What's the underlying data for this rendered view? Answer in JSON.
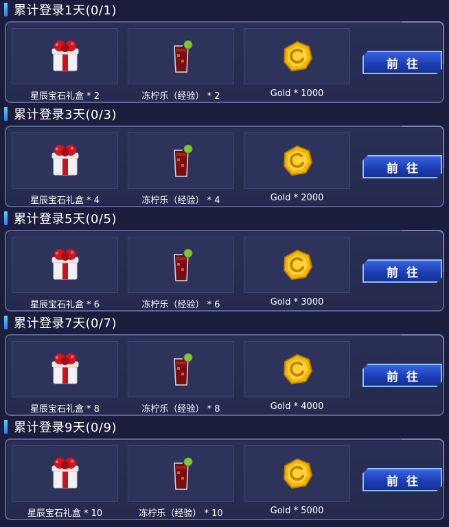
{
  "sections": [
    {
      "title": "累计登录1天(0/1)",
      "rewards": [
        "星辰宝石礼盒 * 2",
        "冻柠乐（经验） * 2",
        "Gold * 1000"
      ],
      "button": "前往"
    },
    {
      "title": "累计登录3天(0/3)",
      "rewards": [
        "星辰宝石礼盒 * 4",
        "冻柠乐（经验） * 4",
        "Gold * 2000"
      ],
      "button": "前往"
    },
    {
      "title": "累计登录5天(0/5)",
      "rewards": [
        "星辰宝石礼盒 * 6",
        "冻柠乐（经验） * 6",
        "Gold * 3000"
      ],
      "button": "前往"
    },
    {
      "title": "累计登录7天(0/7)",
      "rewards": [
        "星辰宝石礼盒 * 8",
        "冻柠乐（经验） * 8",
        "Gold * 4000"
      ],
      "button": "前往"
    },
    {
      "title": "累计登录9天(0/9)",
      "rewards": [
        "星辰宝石礼盒 * 10",
        "冻柠乐（经验） * 10",
        "Gold * 5000"
      ],
      "button": "前往"
    }
  ],
  "icons": [
    "gift-box-icon",
    "cola-drink-icon",
    "gold-coin-icon"
  ],
  "colors": {
    "background": "#1a1e3c",
    "panel": "#2a2f55",
    "button": "#1c3fb6",
    "gold": "#f2b705"
  }
}
